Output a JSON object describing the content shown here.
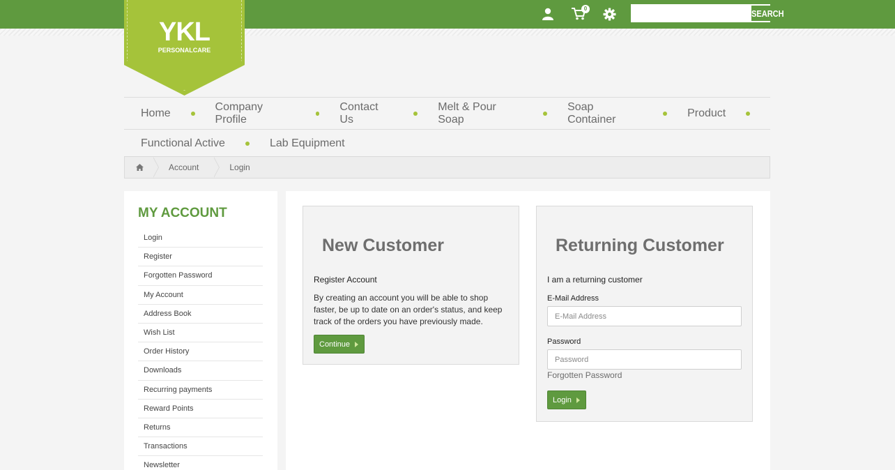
{
  "brand": {
    "title": "YKL",
    "subtitle": "PERSONALCARE"
  },
  "header": {
    "cart_count": "0",
    "search_placeholder": "",
    "search_label": "SEARCH",
    "icons": [
      "user-icon",
      "cart-icon",
      "gear-icon"
    ]
  },
  "nav": {
    "row1": [
      "Home",
      "Company Profile",
      "Contact Us",
      "Melt & Pour Soap",
      "Soap Container",
      "Product"
    ],
    "row2": [
      "Functional Active",
      "Lab Equipment"
    ]
  },
  "breadcrumb": {
    "home_icon": "home-icon",
    "items": [
      "Account",
      "Login"
    ]
  },
  "sidebar": {
    "title": "MY ACCOUNT",
    "items": [
      "Login",
      "Register",
      "Forgotten Password",
      "My Account",
      "Address Book",
      "Wish List",
      "Order History",
      "Downloads",
      "Recurring payments",
      "Reward Points",
      "Returns",
      "Transactions",
      "Newsletter"
    ]
  },
  "new_customer": {
    "title": "New Customer",
    "subtitle": "Register Account",
    "text": "By creating an account you will be able to shop faster, be up to date on an order's status, and keep track of the orders you have previously made.",
    "button": "Continue"
  },
  "returning_customer": {
    "title": "Returning Customer",
    "subtitle": "I am a returning customer",
    "email_label": "E-Mail Address",
    "email_placeholder": "E-Mail Address",
    "password_label": "Password",
    "password_placeholder": "Password",
    "forgot": "Forgotten Password",
    "button": "Login"
  },
  "colors": {
    "brand_green": "#5f9a3f",
    "logo_lime": "#a5c33a"
  }
}
